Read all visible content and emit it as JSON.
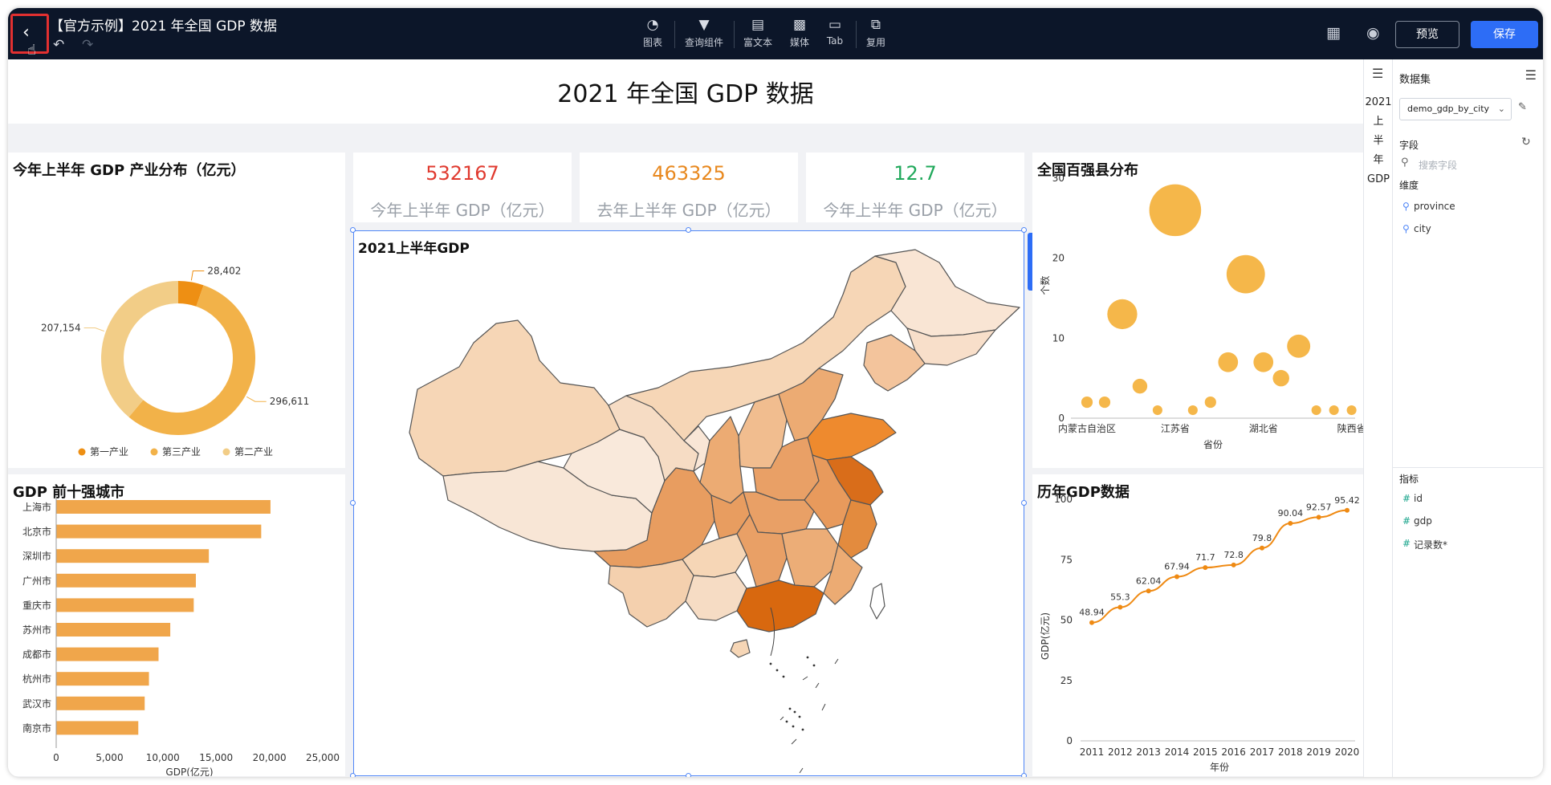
{
  "header": {
    "title": "【官方示例】2021 年全国 GDP 数据",
    "tools": [
      {
        "label": "图表",
        "icon": "pie-chart-icon"
      },
      {
        "label": "查询组件",
        "icon": "filter-icon"
      },
      {
        "label": "富文本",
        "icon": "text-icon"
      },
      {
        "label": "媒体",
        "icon": "image-icon"
      },
      {
        "label": "Tab",
        "icon": "tab-icon"
      },
      {
        "label": "复用",
        "icon": "copy-icon"
      }
    ],
    "preview_label": "预览",
    "save_label": "保存"
  },
  "dashboard": {
    "title": "2021 年全国 GDP 数据",
    "kpis": [
      {
        "value": "532167",
        "label": "今年上半年 GDP（亿元）",
        "color": "#e03a2f"
      },
      {
        "value": "463325",
        "label": "去年上半年 GDP（亿元）",
        "color": "#e8881e"
      },
      {
        "value": "12.7",
        "label": "今年上半年 GDP（亿元）",
        "color": "#1fa85a"
      }
    ],
    "map_title": "2021上半年GDP"
  },
  "chart_data": [
    {
      "type": "pie",
      "title": "今年上半年 GDP 产业分布（亿元）",
      "slices": [
        {
          "name": "第一产业",
          "value": 28402,
          "label": "28,402",
          "color": "#ee8f13"
        },
        {
          "name": "第三产业",
          "value": 296611,
          "label": "296,611",
          "color": "#f2b249"
        },
        {
          "name": "第二产业",
          "value": 207154,
          "label": "207,154",
          "color": "#f2cd87"
        }
      ],
      "legend": "bottom"
    },
    {
      "type": "bar",
      "orientation": "horizontal",
      "title": "GDP 前十强城市",
      "categories": [
        "上海市",
        "北京市",
        "深圳市",
        "广州市",
        "重庆市",
        "苏州市",
        "成都市",
        "杭州市",
        "武汉市",
        "南京市"
      ],
      "values": [
        20100,
        19230,
        14320,
        13100,
        12900,
        10700,
        9600,
        8700,
        8300,
        7700
      ],
      "xlabel": "GDP(亿元)",
      "xlim": [
        0,
        25000
      ],
      "xticks": [
        "0",
        "5,000",
        "10,000",
        "15,000",
        "20,000",
        "25,000"
      ],
      "color": "#f0a64b"
    },
    {
      "type": "scatter",
      "title": "全国百强县分布",
      "ylabel": "个数",
      "xlabel": "省份",
      "ylim": [
        0,
        30
      ],
      "yticks": [
        "0",
        "10",
        "20",
        "30"
      ],
      "xticks": [
        "内蒙古自治区",
        "江苏省",
        "湖北省",
        "陕西省"
      ],
      "points": [
        2,
        2,
        13,
        4,
        1,
        26,
        1,
        2,
        7,
        18,
        7,
        5,
        9,
        1,
        1,
        1
      ],
      "color": "#f5b74a"
    },
    {
      "type": "line",
      "title": "历年GDP数据",
      "x": [
        2011,
        2012,
        2013,
        2014,
        2015,
        2016,
        2017,
        2018,
        2019,
        2020
      ],
      "values": [
        48.94,
        55.3,
        62.04,
        67.94,
        71.7,
        72.8,
        79.8,
        90.04,
        92.57,
        95.42
      ],
      "labels": [
        "48.94",
        "55.3",
        "62.04",
        "67.94",
        "71.7",
        "72.8",
        "79.8",
        "90.04",
        "92.57",
        "95.42"
      ],
      "xlabel": "年份",
      "ylabel": "GDP(亿元)",
      "ylim": [
        0,
        100
      ],
      "yticks": [
        "0",
        "25",
        "50",
        "75",
        "100"
      ],
      "color": "#ef8a13"
    }
  ],
  "sidebar": {
    "vertical_title": [
      "2021",
      "上",
      "半",
      "年",
      "GDP"
    ],
    "dataset_label": "数据集",
    "dataset_value": "demo_gdp_by_city",
    "fields_label": "字段",
    "search_placeholder": "搜索字段",
    "dimensions_label": "维度",
    "dimensions": [
      "province",
      "city"
    ],
    "measures_label": "指标",
    "measures": [
      "id",
      "gdp",
      "记录数*"
    ]
  }
}
